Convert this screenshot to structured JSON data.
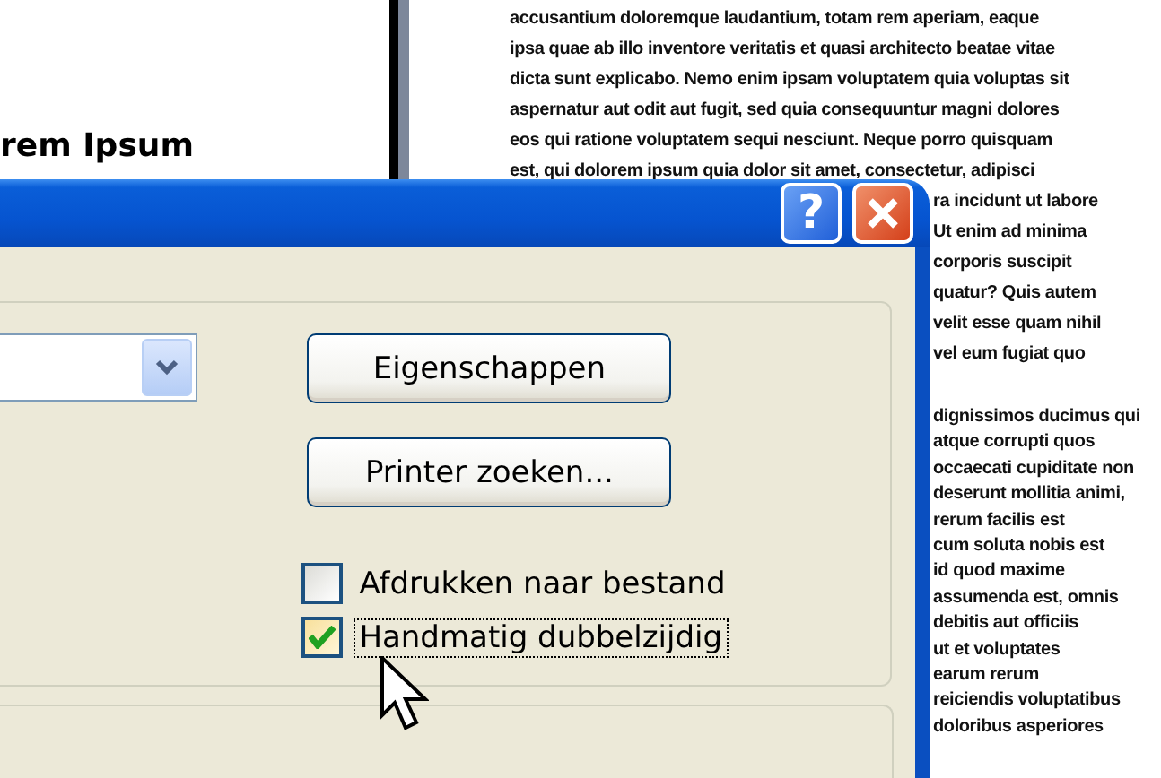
{
  "document": {
    "heading": "rem Ipsum",
    "top_lines": [
      "accusantium doloremque laudantium, totam rem aperiam, eaque",
      "ipsa quae ab illo inventore veritatis et quasi architecto beatae vitae",
      "dicta sunt explicabo. Nemo enim ipsam voluptatem quia voluptas sit",
      "aspernatur aut odit aut fugit, sed quia consequuntur magni dolores",
      "eos qui ratione voluptatem sequi nesciunt. Neque porro quisquam",
      "est, qui dolorem ipsum quia dolor sit amet, consectetur, adipisci"
    ],
    "side_lines": [
      "ra incidunt ut labore",
      "Ut enim ad minima",
      "corporis suscipit",
      "quatur? Quis autem",
      "velit esse quam nihil",
      "vel eum fugiat quo"
    ],
    "side_lines_2": [
      "dignissimos ducimus qui",
      "atque corrupti quos",
      "occaecati cupiditate non",
      "deserunt mollitia animi,",
      "rerum facilis est",
      "cum soluta nobis est",
      "id quod maxime",
      "assumenda est, omnis",
      "debitis aut officiis",
      "ut et voluptates",
      "earum rerum",
      "reiciendis voluptatibus",
      "doloribus asperiores"
    ]
  },
  "dialog": {
    "title_buttons": [
      {
        "kind": "help",
        "label": "?"
      },
      {
        "kind": "close"
      }
    ],
    "buttons": [
      "Eigenschappen",
      "Printer zoeken..."
    ],
    "options": [
      {
        "label": "Afdrukken naar bestand",
        "checked": false,
        "focused": false
      },
      {
        "label": "Handmatig dubbelzijdig",
        "checked": true,
        "focused": true
      }
    ]
  }
}
